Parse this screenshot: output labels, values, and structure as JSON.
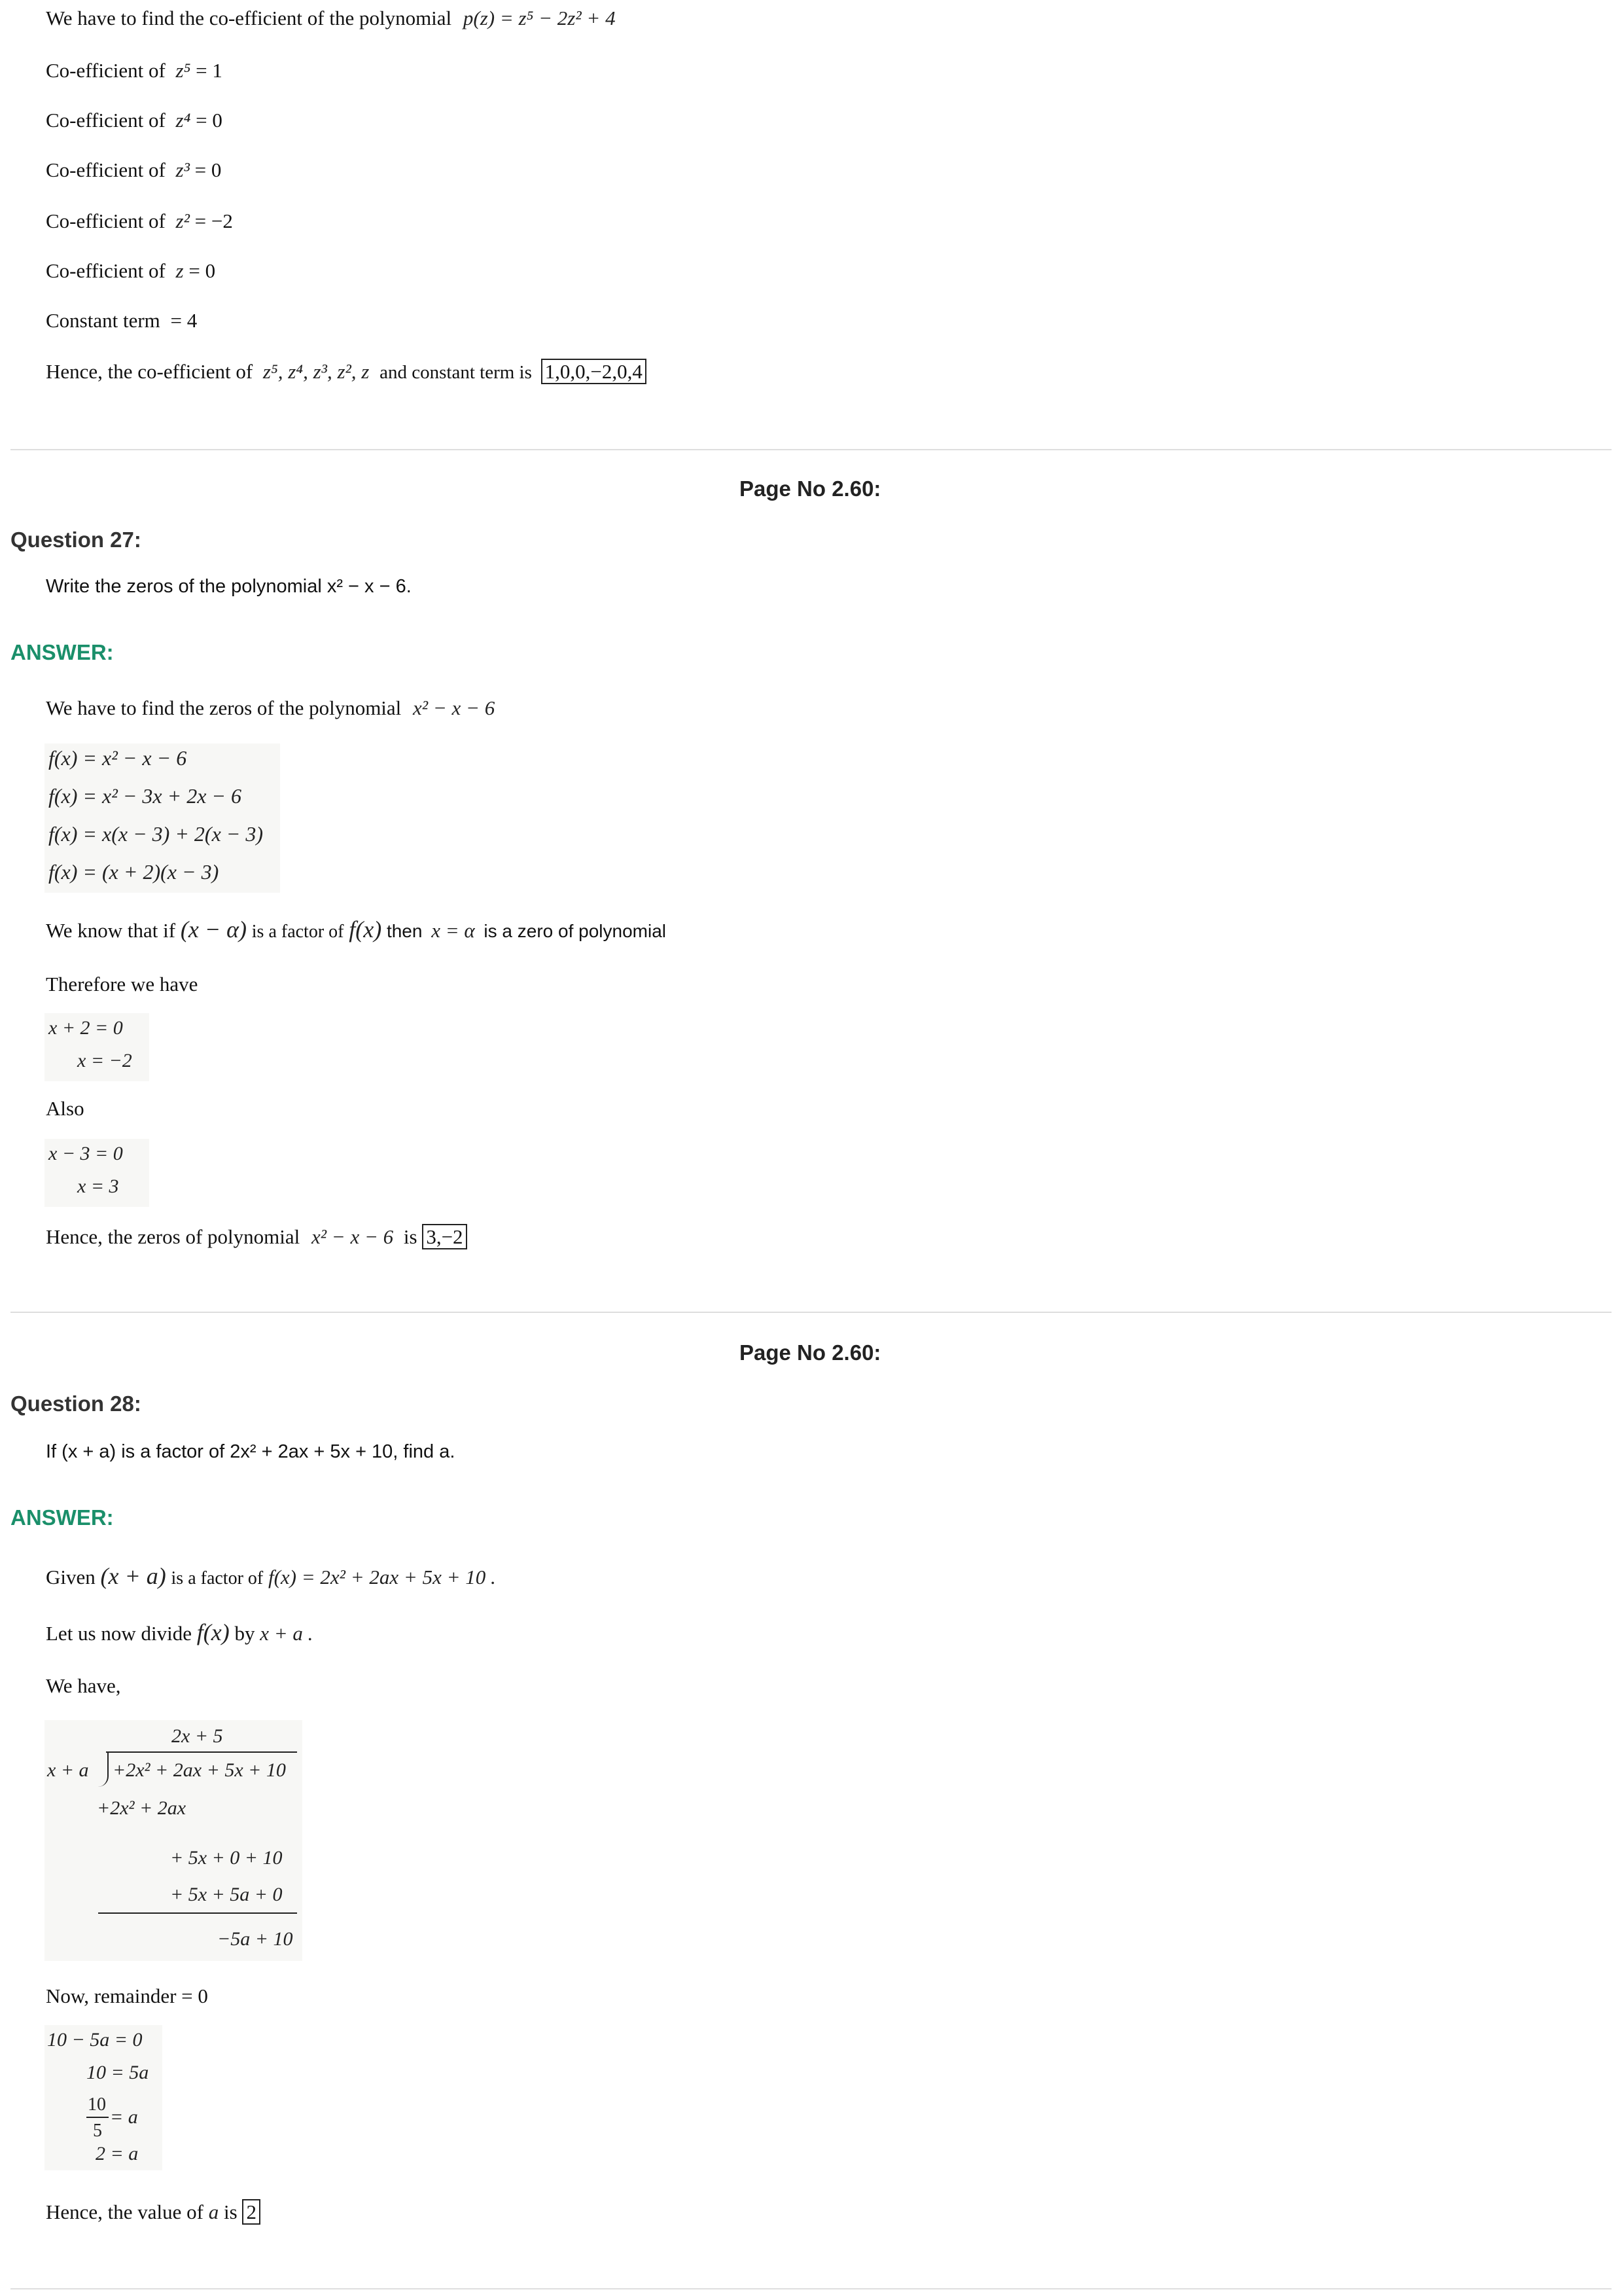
{
  "q26_tail": {
    "intro": "We have to find the co-efficient of the polynomial",
    "poly": "p(z) = z⁵ − 2z² + 4",
    "coefficients": [
      {
        "label": "Co-efficient of",
        "term": "z⁵",
        "value": "= 1"
      },
      {
        "label": "Co-efficient of",
        "term": "z⁴",
        "value": "= 0"
      },
      {
        "label": "Co-efficient of",
        "term": "z³",
        "value": "= 0"
      },
      {
        "label": "Co-efficient of",
        "term": "z²",
        "value": "= −2"
      },
      {
        "label": "Co-efficient of",
        "term": "z",
        "value": "= 0"
      }
    ],
    "constant_label": "Constant term",
    "constant_value": "= 4",
    "hence": "Hence, the co-efficient of",
    "hence_terms": "z⁵, z⁴, z³, z², z",
    "hence_mid": "and constant term is",
    "result": "1,0,0,−2,0,4"
  },
  "q27": {
    "page_no": "Page No 2.60:",
    "heading": "Question 27:",
    "question": "Write the zeros of the polynomial x² − x − 6.",
    "answer_label": "ANSWER:",
    "intro": "We have to find the zeros of the polynomial",
    "intro_poly": "x² − x − 6",
    "steps": [
      "f(x) = x² − x − 6",
      "f(x) = x² − 3x + 2x − 6",
      "f(x) = x(x − 3) + 2(x − 3)",
      "f(x) = (x + 2)(x − 3)"
    ],
    "know_a": "We know that if",
    "know_factor": "(x − α)",
    "know_b": "is a factor of",
    "know_fx": "f(x)",
    "know_c": "then",
    "know_zero": "x = α",
    "know_d": "is a zero of polynomial",
    "therefore": "Therefore we have",
    "eq1": [
      "x + 2 = 0",
      "x = −2"
    ],
    "also": "Also",
    "eq2": [
      "x − 3 = 0",
      "x = 3"
    ],
    "hence": "Hence, the zeros of polynomial",
    "hence_poly": "x² − x − 6",
    "hence_is": "is",
    "result": "3,−2"
  },
  "q28": {
    "page_no": "Page No 2.60:",
    "heading": "Question 28:",
    "question": "If (x + a) is a factor of 2x² + 2ax + 5x + 10, find a.",
    "answer_label": "ANSWER:",
    "given_a": "Given",
    "given_factor": "(x + a)",
    "given_b": "is a factor of",
    "given_f": "f(x) = 2x² + 2ax + 5x + 10 .",
    "divide_a": "Let us now divide",
    "divide_fx": "f(x)",
    "divide_b": "by",
    "divide_c": "x + a .",
    "we_have": "We have,",
    "division": {
      "quotient": "2x + 5",
      "divisor": "x + a",
      "dividend": "+2x² + 2ax + 5x + 10",
      "sub1": "+2x² + 2ax",
      "rem1": "+ 5x + 0   + 10",
      "sub2": "+ 5x + 5a + 0",
      "remainder": "−5a + 10"
    },
    "now_rem": "Now, remainder",
    "now_rem_val": "= 0",
    "solve": [
      "10 − 5a = 0",
      "10 = 5a",
      "= a",
      "2 = a"
    ],
    "frac_num": "10",
    "frac_den": "5",
    "hence": "Hence, the value of",
    "hence_var": "a",
    "hence_is": "is",
    "result": "2"
  }
}
